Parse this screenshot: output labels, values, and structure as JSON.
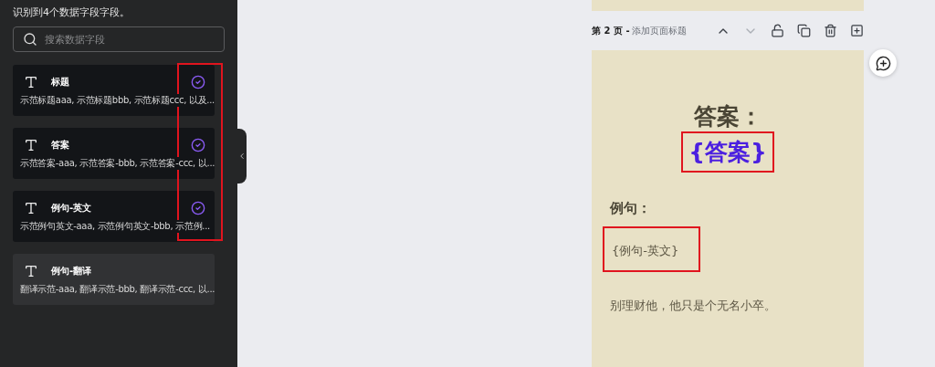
{
  "sidebar": {
    "summary": "识别到4个数据字段字段。",
    "search": {
      "placeholder": "搜索数据字段"
    },
    "checks_highlighted": true,
    "fields": [
      {
        "name": "标题",
        "sample": "示范标题aaa, 示范标题bbb, 示范标题ccc, 以及...",
        "checked": true
      },
      {
        "name": "答案",
        "sample": "示范答案-aaa, 示范答案-bbb, 示范答案-ccc, 以...",
        "checked": true
      },
      {
        "name": "例句-英文",
        "sample": "示范例句英文-aaa, 示范例句英文-bbb, 示范例...",
        "checked": true
      },
      {
        "name": "例句-翻译",
        "sample": "翻译示范-aaa, 翻译示范-bbb, 翻译示范-ccc, 以...",
        "checked": false
      }
    ]
  },
  "page": {
    "number": "第 2 页 -",
    "title_placeholder": "添加页面标题",
    "blocks": [
      {
        "kind": "heading",
        "text": "答案："
      },
      {
        "kind": "field",
        "text": "{答案}",
        "highlighted": true
      },
      {
        "kind": "label",
        "text": "例句："
      },
      {
        "kind": "small_field",
        "text": "{例句-英文}",
        "highlighted": true
      },
      {
        "kind": "body",
        "text": "别理财他，他只是个无名小卒。"
      }
    ]
  }
}
